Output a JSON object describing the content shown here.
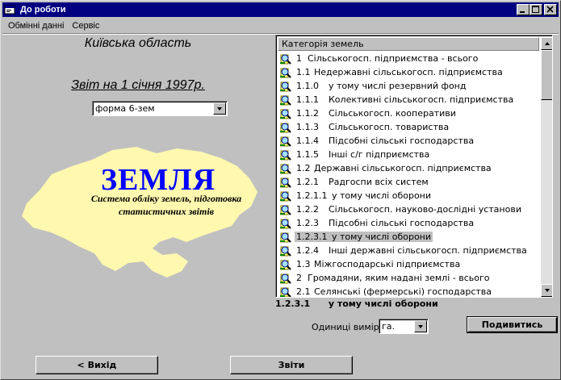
{
  "window": {
    "title": "До роботи",
    "min": "_",
    "max": "□",
    "close": "×"
  },
  "menu": [
    "Обмінні данні",
    "Сервіс"
  ],
  "left": {
    "region": "Київська область",
    "report": "Звіт на 1 січня 1997р.",
    "form_select": "форма 6-зем",
    "logo": "ЗЕМЛЯ",
    "logo_sub_1": "Система обліку земель, підготовка",
    "logo_sub_2": "статистичних звітів"
  },
  "list": {
    "header": "Категорія земель",
    "rows": [
      {
        "code": "1",
        "label": "Сільськогосп. підприємства - всього"
      },
      {
        "code": "1.1",
        "label": "Недержавні сільськогосп. підприємства"
      },
      {
        "code": "1.1.0",
        "label": "у тому числі резервний фонд"
      },
      {
        "code": "1.1.1",
        "label": "Колективні сільськогосп. підприємства"
      },
      {
        "code": "1.1.2",
        "label": "Сільськогосп. кооперативи"
      },
      {
        "code": "1.1.3",
        "label": "Сільськогосп. товариства"
      },
      {
        "code": "1.1.4",
        "label": "Підсобні сільські господарства"
      },
      {
        "code": "1.1.5",
        "label": "Інші с/г підприємства"
      },
      {
        "code": "1.2",
        "label": "Державні сільськогосп. підприємства"
      },
      {
        "code": "1.2.1",
        "label": "Радгоспи всіх систем"
      },
      {
        "code": "1.2.1.1",
        "label": "у тому числі оборони"
      },
      {
        "code": "1.2.2",
        "label": "Сільськогосп. науково-дослідні установи"
      },
      {
        "code": "1.2.3",
        "label": "Підсобні сільські  господарства"
      },
      {
        "code": "1.2.3.1",
        "label": "у тому числі оборони"
      },
      {
        "code": "1.2.4",
        "label": "Інші державні сільськогосп. підприємства"
      },
      {
        "code": "1.3",
        "label": "Міжгосподарські підприємства"
      },
      {
        "code": "2",
        "label": "Громадяни, яким надані землі - всього"
      },
      {
        "code": "2.1",
        "label": "Селянські (фермерські) господарства"
      }
    ],
    "selected_index": 13
  },
  "selected": {
    "code": "1.2.3.1",
    "label": "у тому числі оборони"
  },
  "units": {
    "label": "Одиниці виміру :",
    "value": "га."
  },
  "buttons": {
    "view": "Подивитись",
    "exit": "< Вихід",
    "reports": "Звіти"
  },
  "colors": {
    "titlebar": "#000080",
    "logo": "#0000ff",
    "map": "#fff9b0"
  }
}
